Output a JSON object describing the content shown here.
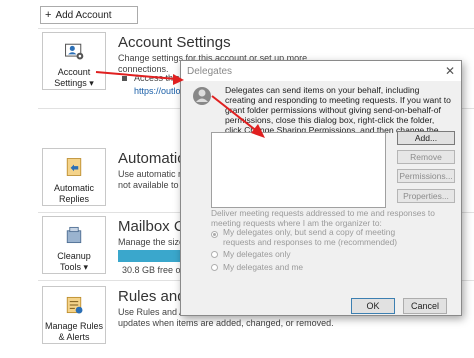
{
  "top": {
    "add_account_label": "Add Account",
    "plus": "+"
  },
  "sections": [
    {
      "tile_label_1": "Account",
      "tile_label_2": "Settings ▾",
      "title": "Account Settings",
      "desc_line1": "Change settings for this account or set up more",
      "desc_line2": "connections.",
      "bullet": "Access this",
      "link": "https://outlo"
    },
    {
      "tile_label_1": "Automatic",
      "tile_label_2": "Replies",
      "title": "Automatic R",
      "desc_line1": "Use automatic repl",
      "desc_line2": "not available to re"
    },
    {
      "tile_label_1": "Cleanup",
      "tile_label_2": "Tools ▾",
      "title": "Mailbox Cle",
      "desc_line1": "Manage the size o",
      "storage_text": "30.8 GB free o"
    },
    {
      "tile_label_1": "Manage Rules",
      "tile_label_2": "& Alerts",
      "title": "Rules and A",
      "desc_line1": "Use Rules and Ale",
      "desc_line2": "updates when items are added, changed, or removed."
    }
  ],
  "dialog": {
    "title": "Delegates",
    "close": "✕",
    "intro": "Delegates can send items on your behalf, including creating and responding to meeting requests. If you want to grant folder permissions without giving send-on-behalf-of permissions, close this dialog box, right-click the folder, click Change Sharing Permissions, and then change the options on the Permissions tab.",
    "buttons": {
      "add": "Add...",
      "remove": "Remove",
      "permissions": "Permissions...",
      "properties": "Properties..."
    },
    "deliver_label": "Deliver meeting requests addressed to me and responses to meeting requests where I am the organizer to:",
    "options": [
      {
        "label": "My delegates only, but send a copy of meeting requests and responses to me (recommended)",
        "selected": true
      },
      {
        "label": "My delegates only",
        "selected": false
      },
      {
        "label": "My delegates and me",
        "selected": false
      }
    ],
    "ok": "OK",
    "cancel": "Cancel"
  },
  "colors": {
    "arrow": "#e02020",
    "storage_bar": "#3aa7cc"
  }
}
